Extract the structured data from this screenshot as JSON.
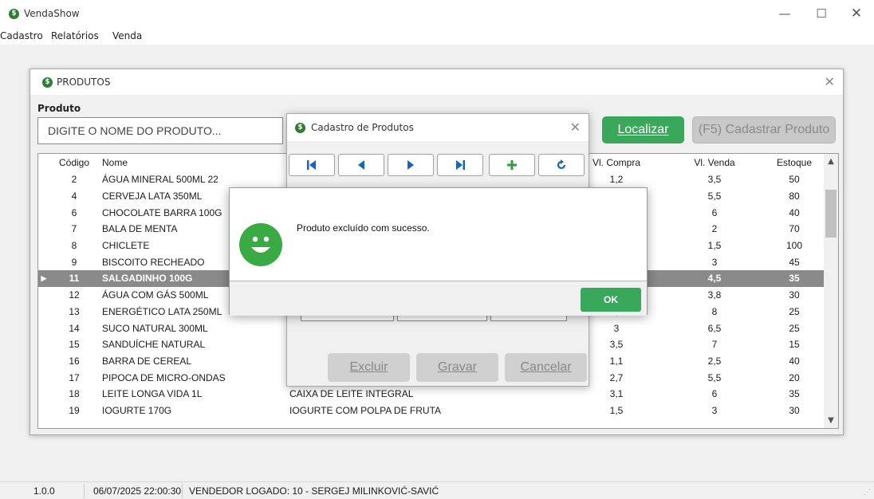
{
  "app": {
    "title": "VendaShow",
    "logo_glyph": "$"
  },
  "menu": {
    "items": [
      "Cadastro",
      "Relatórios",
      "Venda"
    ]
  },
  "status": {
    "version": "1.0.0",
    "datetime": "06/07/2025 22:00:30",
    "vendedor": "VENDEDOR LOGADO:  10 - SERGEJ MILINKOVIĆ-SAVIĆ"
  },
  "produtos": {
    "title": "PRODUTOS",
    "search_label": "Produto",
    "search_placeholder": "DIGITE O NOME DO PRODUTO...",
    "localizar_label": "Localizar",
    "cadastrar_label": "(F5) Cadastrar Produto",
    "columns": [
      "Código",
      "Nome",
      "",
      "Vl. Compra",
      "Vl. Venda",
      "Estoque"
    ],
    "rows": [
      {
        "codigo": "2",
        "nome": "ÁGUA MINERAL 500ML   22",
        "descricao": "",
        "compra": "1,2",
        "venda": "3,5",
        "estoque": "50"
      },
      {
        "codigo": "4",
        "nome": "CERVEJA LATA 350ML",
        "descricao": "",
        "compra": "",
        "venda": "5,5",
        "estoque": "80"
      },
      {
        "codigo": "6",
        "nome": "CHOCOLATE BARRA 100G",
        "descricao": "",
        "compra": "",
        "venda": "6",
        "estoque": "40"
      },
      {
        "codigo": "7",
        "nome": "BALA DE MENTA",
        "descricao": "",
        "compra": "",
        "venda": "2",
        "estoque": "70"
      },
      {
        "codigo": "8",
        "nome": "CHICLETE",
        "descricao": "",
        "compra": "",
        "venda": "1,5",
        "estoque": "100"
      },
      {
        "codigo": "9",
        "nome": "BISCOITO RECHEADO",
        "descricao": "",
        "compra": "",
        "venda": "3",
        "estoque": "45"
      },
      {
        "codigo": "11",
        "nome": "SALGADINHO 100G",
        "descricao": "",
        "compra": "",
        "venda": "4,5",
        "estoque": "35",
        "selected": true
      },
      {
        "codigo": "12",
        "nome": "ÁGUA COM GÁS 500ML",
        "descricao": "",
        "compra": "",
        "venda": "3,8",
        "estoque": "30"
      },
      {
        "codigo": "13",
        "nome": "ENERGÉTICO LATA 250ML",
        "descricao": "",
        "compra": "4,2",
        "venda": "8",
        "estoque": "25"
      },
      {
        "codigo": "14",
        "nome": "SUCO NATURAL 300ML",
        "descricao": "",
        "compra": "3",
        "venda": "6,5",
        "estoque": "25"
      },
      {
        "codigo": "15",
        "nome": "SANDUÍCHE NATURAL",
        "descricao": "",
        "compra": "3,5",
        "venda": "7",
        "estoque": "15"
      },
      {
        "codigo": "16",
        "nome": "BARRA DE CEREAL",
        "descricao": "",
        "compra": "1,1",
        "venda": "2,5",
        "estoque": "40"
      },
      {
        "codigo": "17",
        "nome": "PIPOCA DE MICRO-ONDAS",
        "descricao": "",
        "compra": "2,7",
        "venda": "5,5",
        "estoque": "20"
      },
      {
        "codigo": "18",
        "nome": "LEITE LONGA VIDA 1L",
        "descricao": "CAIXA DE LEITE INTEGRAL",
        "compra": "3,1",
        "venda": "6",
        "estoque": "35"
      },
      {
        "codigo": "19",
        "nome": "IOGURTE 170G",
        "descricao": "IOGURTE COM POLPA DE FRUTA",
        "compra": "1,5",
        "venda": "3",
        "estoque": "30"
      }
    ]
  },
  "cadastro": {
    "title": "Cadastro de Produtos",
    "nav_buttons": [
      "first-record-icon",
      "previous-record-icon",
      "next-record-icon",
      "last-record-icon",
      "add-record-icon",
      "refresh-icon"
    ],
    "excluir_label": "Excluir",
    "gravar_label": "Gravar",
    "cancelar_label": "Cancelar"
  },
  "message": {
    "text": "Produto excluído com sucesso.",
    "ok_label": "OK",
    "icon": "smiley-icon"
  },
  "colors": {
    "accent_green": "#3aa85a",
    "selected_row": "#8a8a8a",
    "nav_blue": "#1565c0"
  }
}
